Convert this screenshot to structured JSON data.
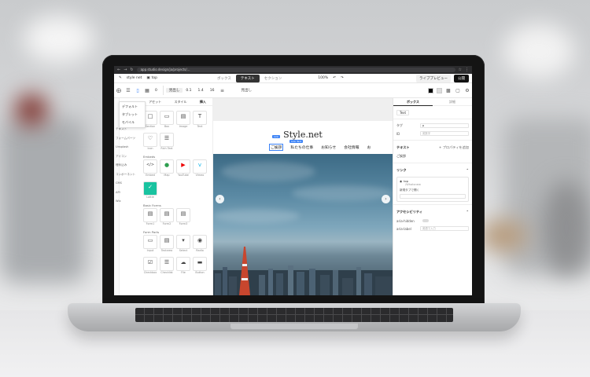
{
  "browser": {
    "url": "app.studio.design/ja/projects/..."
  },
  "app": {
    "project_name": "style net",
    "page_name": "top",
    "mode_tabs": [
      "ボックス",
      "テキスト",
      "セクション"
    ],
    "active_mode": "テキスト",
    "zoom": "100%",
    "live_preview_label": "ライブプレビュー",
    "publish_label": "公開"
  },
  "toolbar": {
    "style_value": "見出し",
    "font_weight": "0",
    "line_height": "0.1",
    "letter_spacing": "1.4",
    "font_size": "16",
    "text_style": "見出し",
    "color_hex": "#000000",
    "text_color": "#000000"
  },
  "device_menu": [
    "デフォルト",
    "タブレット",
    "モバイル"
  ],
  "left_categories": [
    "テキスト",
    "フォームパーツ",
    "Unsplash",
    "アイコン",
    "埋め込み",
    "コンポーネント",
    "CMS",
    "API",
    "Wix"
  ],
  "palette": {
    "tabs": [
      "アセット",
      "スタイル",
      "挿入"
    ],
    "active_tab": "挿入",
    "sections": [
      {
        "title": "",
        "items": [
          {
            "icon": "section-icon",
            "label": "Section"
          },
          {
            "icon": "box-icon",
            "label": "Box"
          },
          {
            "icon": "image-icon",
            "label": "Image"
          },
          {
            "icon": "text-icon",
            "label": "Text"
          },
          {
            "icon": "heart-icon",
            "label": "Icon"
          },
          {
            "icon": "richtext-icon",
            "label": "Rich Text"
          }
        ]
      },
      {
        "title": "Embeds",
        "items": [
          {
            "icon": "embed-icon",
            "label": "Embed"
          },
          {
            "icon": "map-pin-icon",
            "label": "Map"
          },
          {
            "icon": "youtube-icon",
            "label": "YouTube"
          },
          {
            "icon": "vimeo-icon",
            "label": "Vimeo"
          },
          {
            "icon": "lottie-icon",
            "label": "Lottie"
          }
        ]
      },
      {
        "title": "Basic Forms",
        "items": [
          {
            "icon": "form-icon",
            "label": "Form1"
          },
          {
            "icon": "form-icon",
            "label": "Form2"
          },
          {
            "icon": "form-icon",
            "label": "Form3"
          }
        ]
      },
      {
        "title": "Form Parts",
        "items": [
          {
            "icon": "input-icon",
            "label": "Input"
          },
          {
            "icon": "textarea-icon",
            "label": "Textarea"
          },
          {
            "icon": "select-icon",
            "label": "Select"
          },
          {
            "icon": "radio-icon",
            "label": "Radio"
          },
          {
            "icon": "checkbox-icon",
            "label": "Checkbox"
          },
          {
            "icon": "list-icon",
            "label": "Checklist"
          },
          {
            "icon": "file-icon",
            "label": "File"
          },
          {
            "icon": "button-icon",
            "label": "Button"
          }
        ]
      }
    ]
  },
  "canvas": {
    "site_title": "Style.net",
    "nav": [
      "ご挨拶",
      "私たちの仕事",
      "お知らせ",
      "会社情報",
      "お"
    ],
    "selected_nav": "ご挨拶",
    "badge_text": "Link Text",
    "section_badge": "Link"
  },
  "right_panel": {
    "tabs": [
      "ボックス",
      "詳細"
    ],
    "active_tab": "ボックス",
    "tag_label": "Text",
    "rows": [
      {
        "label": "タグ",
        "value": "p"
      },
      {
        "label": "ID",
        "value": "英数字"
      }
    ],
    "text_section_title": "テキスト",
    "text_section_action": "+ プロパティを追加",
    "text_value": "ご挨拶",
    "link_section_title": "リンク",
    "link_target": "top",
    "link_target_sub": "/Whatsnew",
    "link_new_tab": "新規タブで開く",
    "a11y_title": "アクセシビリティ",
    "a11y_rows": [
      {
        "label": "aria-hidden",
        "value": ""
      },
      {
        "label": "aria-label",
        "value": "英語で入力"
      }
    ]
  }
}
